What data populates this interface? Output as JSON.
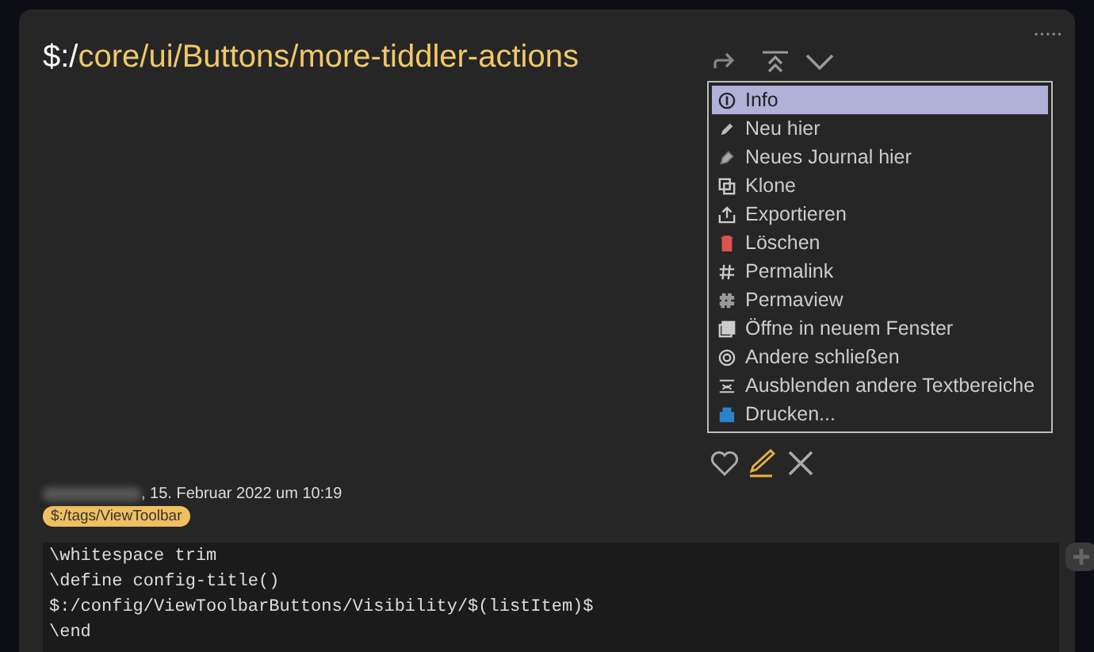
{
  "tiddler": {
    "title_prefix": "$:/",
    "title_path": "core/ui/Buttons/more-tiddler-actions"
  },
  "menu": [
    {
      "label": "Info",
      "kind": "info",
      "selected": true
    },
    {
      "label": "Neu hier",
      "kind": "new",
      "selected": false
    },
    {
      "label": "Neues Journal hier",
      "kind": "journal",
      "selected": false
    },
    {
      "label": "Klone",
      "kind": "clone",
      "selected": false
    },
    {
      "label": "Exportieren",
      "kind": "export",
      "selected": false
    },
    {
      "label": "Löschen",
      "kind": "delete",
      "selected": false
    },
    {
      "label": "Permalink",
      "kind": "hash",
      "selected": false
    },
    {
      "label": "Permaview",
      "kind": "hashbold",
      "selected": false
    },
    {
      "label": "Öffne in neuem Fenster",
      "kind": "window",
      "selected": false
    },
    {
      "label": "Andere schließen",
      "kind": "others",
      "selected": false
    },
    {
      "label": "Ausblenden andere Textbereiche",
      "kind": "fold",
      "selected": false
    },
    {
      "label": "Drucken...",
      "kind": "print",
      "selected": false
    }
  ],
  "meta": {
    "date": ", 15. Februar 2022 um 10:19",
    "tag": "$:/tags/ViewToolbar"
  },
  "code": [
    "\\whitespace trim",
    "\\define config-title()",
    "$:/config/ViewToolbarButtons/Visibility/$(listItem)$",
    "\\end"
  ]
}
